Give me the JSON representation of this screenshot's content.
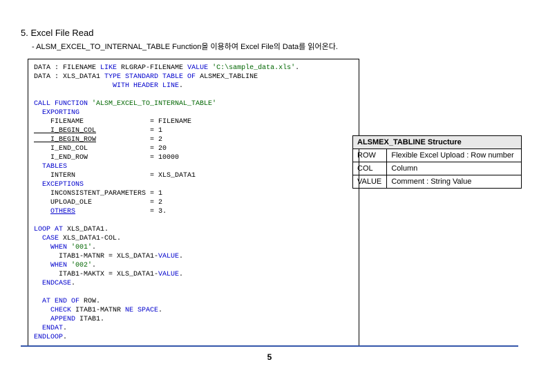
{
  "title": "5. Excel File Read",
  "subtitle": "- ALSM_EXCEL_TO_INTERNAL_TABLE Function을 이용하여 Excel File의 Data를 읽어온다.",
  "code": {
    "l1a": "DATA : FILENAME ",
    "l1b": "LIKE",
    "l1c": " RLGRAP-FILENAME ",
    "l1d": "VALUE",
    "l1e": " 'C:\\sample_data.xls'",
    "l1f": ".",
    "l2a": "DATA : XLS_DATA1 ",
    "l2b": "TYPE STANDARD TABLE OF",
    "l2c": " ALSMEX_TABLINE",
    "l3a": "                   ",
    "l3b": "WITH HEADER LINE",
    "l3c": ".",
    "l5a": "CALL FUNCTION",
    "l5b": " 'ALSM_EXCEL_TO_INTERNAL_TABLE'",
    "l6a": "  EXPORTING",
    "l7a": "    FILENAME                = FILENAME",
    "l8a": "    I_BEGIN_COL",
    "l8b": "             = ",
    "l8c": "1",
    "l9a": "    I_BEGIN_ROW",
    "l9b": "             = ",
    "l9c": "2",
    "l10a": "    I_END_COL               = ",
    "l10b": "20",
    "l11a": "    I_END_ROW               = ",
    "l11b": "10000",
    "l12a": "  TABLES",
    "l13a": "    INTERN                  = XLS_DATA1",
    "l14a": "  EXCEPTIONS",
    "l15a": "    INCONSISTENT_PARAMETERS = ",
    "l15b": "1",
    "l16a": "    UPLOAD_OLE              = ",
    "l16b": "2",
    "l17a": "    ",
    "l17b": "OTHERS",
    "l17c": "                  = ",
    "l17d": "3",
    "l17e": ".",
    "l19a": "LOOP AT",
    "l19b": " XLS_DATA1.",
    "l20a": "  CASE",
    "l20b": " XLS_DATA1-COL.",
    "l21a": "    WHEN",
    "l21b": " '001'",
    "l21c": ".",
    "l22a": "      ITAB1-MATNR = XLS_DATA1-",
    "l22b": "VALUE",
    "l22c": ".",
    "l23a": "    WHEN",
    "l23b": " '002'",
    "l23c": ".",
    "l24a": "      ITAB1-MAKTX = XLS_DATA1-",
    "l24b": "VALUE",
    "l24c": ".",
    "l25a": "  ENDCASE",
    "l25b": ".",
    "l27a": "  AT END OF",
    "l27b": " ROW.",
    "l28a": "    CHECK",
    "l28b": " ITAB1-MATNR ",
    "l28c": "NE SPACE",
    "l28d": ".",
    "l29a": "    APPEND",
    "l29b": " ITAB1.",
    "l30a": "  ENDAT",
    "l30b": ".",
    "l31a": "ENDLOOP",
    "l31b": "."
  },
  "table": {
    "header": "ALSMEX_TABLINE Structure",
    "rows": [
      {
        "field": "ROW",
        "desc": "Flexible Excel Upload : Row number"
      },
      {
        "field": "COL",
        "desc": "Column"
      },
      {
        "field": "VALUE",
        "desc": "Comment : String Value"
      }
    ]
  },
  "page_num": "5"
}
